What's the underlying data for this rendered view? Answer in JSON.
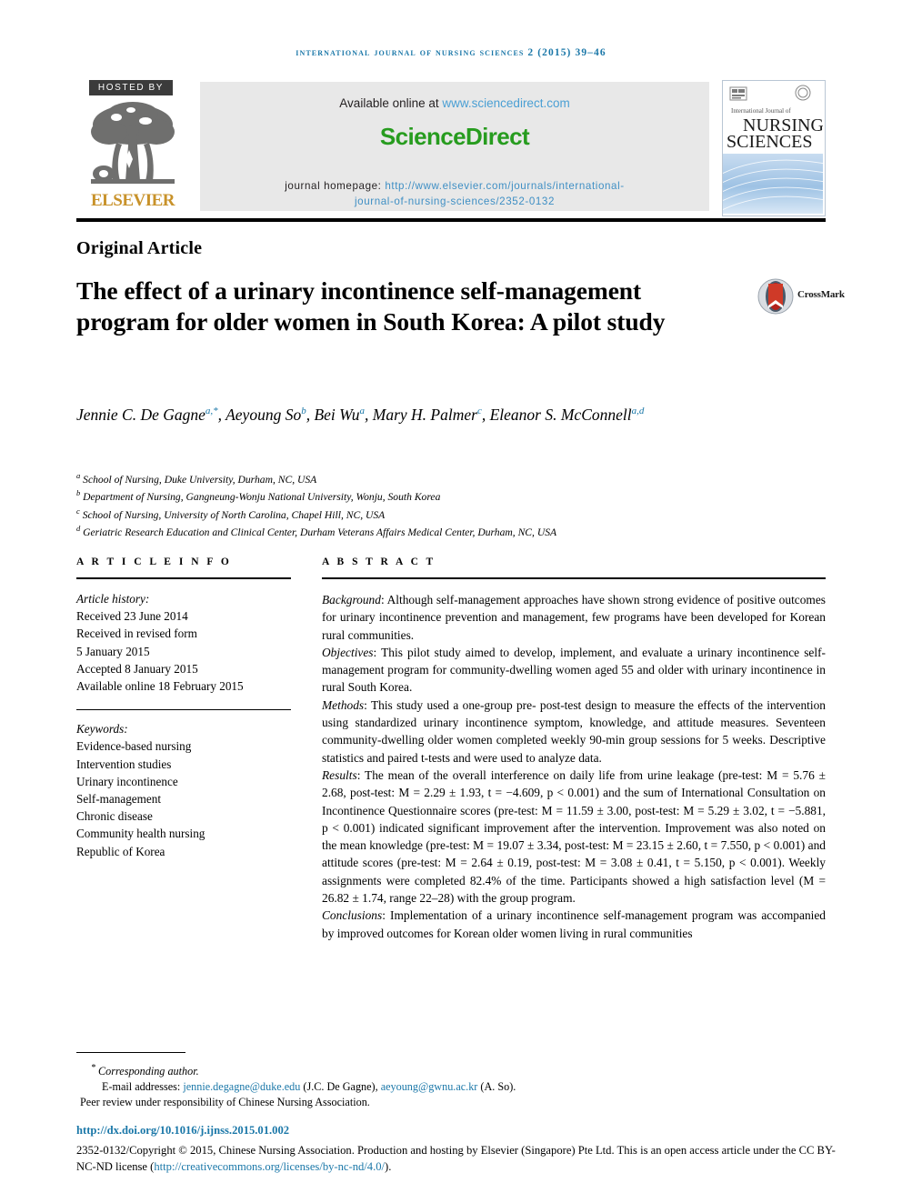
{
  "running_head": "International Journal of Nursing Sciences 2 (2015) 39–46",
  "masthead": {
    "hosted_by": "HOSTED BY",
    "publisher": "ELSEVIER",
    "available_prefix": "Available online at",
    "available_url": "www.sciencedirect.com",
    "sciencedirect_logo": "ScienceDirect",
    "homepage_label": "journal homepage:",
    "homepage_url_line1": "http://www.elsevier.com/journals/international-",
    "homepage_url_line2": "journal-of-nursing-sciences/2352-0132",
    "cover": {
      "small_top_line": "International Journal of",
      "title_line1": "NURSING",
      "title_line2": "SCIENCES"
    }
  },
  "article": {
    "type": "Original Article",
    "title": "The effect of a urinary incontinence self-management program for older women in South Korea: A pilot study",
    "crossmark_label": "CrossMark"
  },
  "authors": {
    "list": [
      {
        "name": "Jennie C. De Gagne",
        "marks": "a,*"
      },
      {
        "name": "Aeyoung So",
        "marks": "b"
      },
      {
        "name": "Bei Wu",
        "marks": "a"
      },
      {
        "name": "Mary H. Palmer",
        "marks": "c"
      },
      {
        "name": "Eleanor S. McConnell",
        "marks": "a,d"
      }
    ],
    "affiliations": [
      {
        "mark": "a",
        "text": "School of Nursing, Duke University, Durham, NC, USA"
      },
      {
        "mark": "b",
        "text": "Department of Nursing, Gangneung-Wonju National University, Wonju, South Korea"
      },
      {
        "mark": "c",
        "text": "School of Nursing, University of North Carolina, Chapel Hill, NC, USA"
      },
      {
        "mark": "d",
        "text": "Geriatric Research Education and Clinical Center, Durham Veterans Affairs Medical Center, Durham, NC, USA"
      }
    ]
  },
  "article_info": {
    "heading": "A R T I C L E  I N F O",
    "history_label": "Article history:",
    "history": [
      "Received 23 June 2014",
      "Received in revised form",
      "5 January 2015",
      "Accepted 8 January 2015",
      "Available online 18 February 2015"
    ],
    "keywords_label": "Keywords:",
    "keywords": [
      "Evidence-based nursing",
      "Intervention studies",
      "Urinary incontinence",
      "Self-management",
      "Chronic disease",
      "Community health nursing",
      "Republic of Korea"
    ]
  },
  "abstract": {
    "heading": "A B S T R A C T",
    "sections": [
      {
        "label": "Background",
        "text": ": Although self-management approaches have shown strong evidence of positive outcomes for urinary incontinence prevention and management, few programs have been developed for Korean rural communities."
      },
      {
        "label": "Objectives",
        "text": ": This pilot study aimed to develop, implement, and evaluate a urinary incontinence self-management program for community-dwelling women aged 55 and older with urinary incontinence in rural South Korea."
      },
      {
        "label": "Methods",
        "text": ": This study used a one-group pre- post-test design to measure the effects of the intervention using standardized urinary incontinence symptom, knowledge, and attitude measures. Seventeen community-dwelling older women completed weekly 90-min group sessions for 5 weeks. Descriptive statistics and paired t-tests and were used to analyze data."
      },
      {
        "label": "Results",
        "text": ": The mean of the overall interference on daily life from urine leakage (pre-test: M = 5.76 ± 2.68, post-test: M = 2.29 ± 1.93, t = −4.609, p < 0.001) and the sum of International Consultation on Incontinence Questionnaire scores (pre-test: M = 11.59 ± 3.00, post-test: M = 5.29 ± 3.02, t = −5.881, p < 0.001) indicated significant improvement after the intervention. Improvement was also noted on the mean knowledge (pre-test: M = 19.07 ± 3.34, post-test: M = 23.15 ± 2.60, t = 7.550, p < 0.001) and attitude scores (pre-test: M = 2.64 ± 0.19, post-test: M = 3.08 ± 0.41, t = 5.150, p < 0.001). Weekly assignments were completed 82.4% of the time. Participants showed a high satisfaction level (M = 26.82 ± 1.74, range 22–28) with the group program."
      },
      {
        "label": "Conclusions",
        "text": ": Implementation of a urinary incontinence self-management program was accompanied by improved outcomes for Korean older women living in rural communities"
      }
    ]
  },
  "footer": {
    "corresponding_author": "Corresponding author.",
    "email_label": "E-mail addresses:",
    "email1": "jennie.degagne@duke.edu",
    "email1_owner": "(J.C. De Gagne),",
    "email2": "aeyoung@gwnu.ac.kr",
    "email2_owner": "(A. So).",
    "peer_review": "Peer review under responsibility of Chinese Nursing Association.",
    "doi": "http://dx.doi.org/10.1016/j.ijnss.2015.01.002",
    "copyright_line1": "2352-0132/Copyright © 2015, Chinese Nursing Association. Production and hosting by Elsevier (Singapore) Pte Ltd. This is an open access",
    "copyright_line2_pre": "article under the CC BY-NC-ND license (",
    "copyright_license_url": "http://creativecommons.org/licenses/by-nc-nd/4.0/",
    "copyright_line2_post": ")."
  },
  "colors": {
    "link_blue": "#1a77a8",
    "sciencedirect_green": "#279c1f",
    "elsevier_orange": "#c8922a",
    "banner_gray": "#e8e8e8"
  }
}
